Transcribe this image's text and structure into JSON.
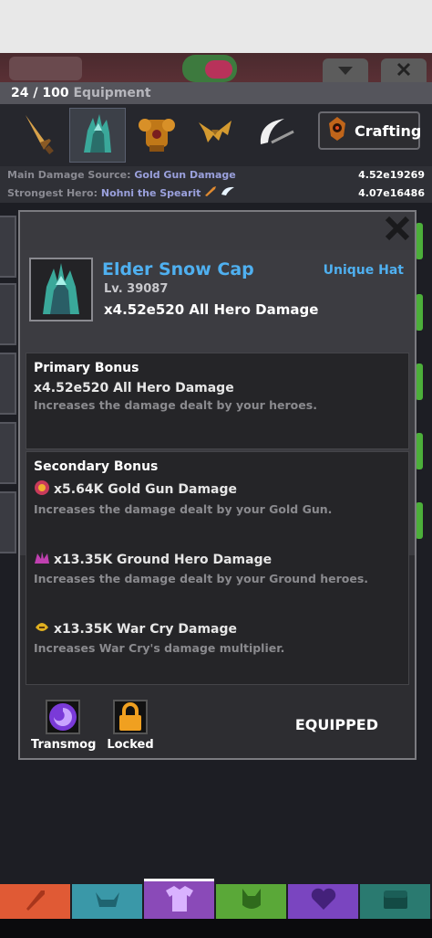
{
  "header": {
    "count": "24 / 100",
    "label": "Equipment",
    "crafting_label": "Crafting"
  },
  "categories": [
    {
      "icon": "sword-icon"
    },
    {
      "icon": "hat-icon",
      "active": true
    },
    {
      "icon": "armor-icon"
    },
    {
      "icon": "wing-icon"
    },
    {
      "icon": "slash-icon"
    }
  ],
  "stats": {
    "main_damage_key": "Main Damage Source:",
    "main_damage_val": "Gold Gun Damage",
    "main_damage_num": "4.52e19269",
    "strongest_key": "Strongest Hero:",
    "strongest_val": "Nohni the Spearit",
    "strongest_num": "4.07e16486"
  },
  "item": {
    "name": "Elder Snow Cap",
    "level": "Lv. 39087",
    "main": "x4.52e520 All Hero Damage",
    "type": "Unique Hat"
  },
  "primary": {
    "title": "Primary Bonus",
    "line": "x4.52e520 All Hero Damage",
    "desc": "Increases the damage dealt by your heroes."
  },
  "secondary": {
    "title": "Secondary Bonus",
    "items": [
      {
        "line": "x5.64K Gold Gun Damage",
        "desc": "Increases the damage dealt by your Gold Gun.",
        "icon": "gold-gun-icon",
        "color": "#c83a5a"
      },
      {
        "line": "x13.35K Ground Hero Damage",
        "desc": "Increases the damage dealt by your Ground heroes.",
        "icon": "ground-hero-icon",
        "color": "#c040b0"
      },
      {
        "line": "x13.35K War Cry Damage",
        "desc": "Increases War Cry's damage multiplier.",
        "icon": "war-cry-icon",
        "color": "#e0b020"
      }
    ]
  },
  "footer": {
    "transmog": "Transmog",
    "locked": "Locked",
    "status": "EQUIPPED"
  },
  "nav": [
    {
      "icon": "sword-nav-icon",
      "color": "#e05a35"
    },
    {
      "icon": "viking-nav-icon",
      "color": "#3a98a8"
    },
    {
      "icon": "shirt-nav-icon",
      "color": "#8a4ab8",
      "active": true
    },
    {
      "icon": "demon-nav-icon",
      "color": "#5aa838"
    },
    {
      "icon": "heart-nav-icon",
      "color": "#7a45c0"
    },
    {
      "icon": "chest-nav-icon",
      "color": "#2a7a70"
    }
  ],
  "colors": {
    "accent_blue": "#4fb0f0",
    "stat_value": "#9aa0dc",
    "background": "#1d1e24"
  }
}
